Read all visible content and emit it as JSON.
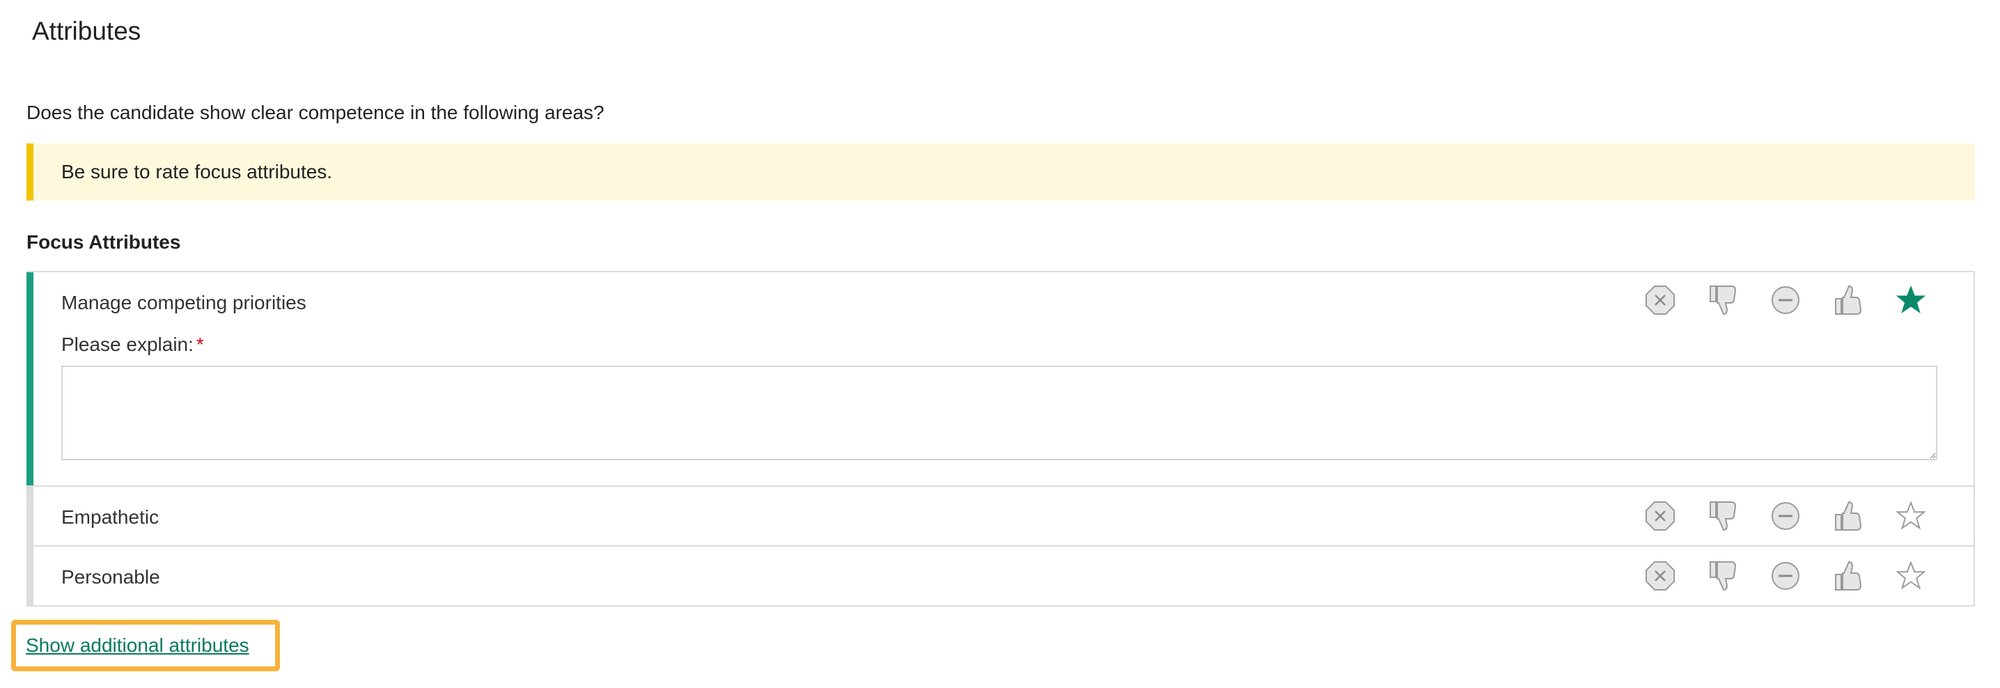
{
  "page": {
    "title": "Attributes"
  },
  "question": "Does the candidate show clear competence in the following areas?",
  "notice": {
    "text": "Be sure to rate focus attributes.",
    "accent": "#f2c300",
    "background": "#fef9dd"
  },
  "focus_section": {
    "heading": "Focus Attributes",
    "attributes": [
      {
        "name": "Manage competing priorities",
        "selected_rating": "strong-yes",
        "explain_label": "Please explain:",
        "required_mark": "*",
        "explain_value": ""
      },
      {
        "name": "Empathetic",
        "selected_rating": null
      },
      {
        "name": "Personable",
        "selected_rating": null
      }
    ],
    "rating_options": [
      "definitely-not-icon",
      "thumbs-down-icon",
      "mixed-icon",
      "thumbs-up-icon",
      "star-icon"
    ]
  },
  "links": {
    "show_additional": "Show additional attributes"
  },
  "colors": {
    "active_accent": "#1a9e80",
    "link": "#0b7a5d",
    "highlight": "#f7b23b",
    "icon_gray": "#9a9a9a"
  }
}
